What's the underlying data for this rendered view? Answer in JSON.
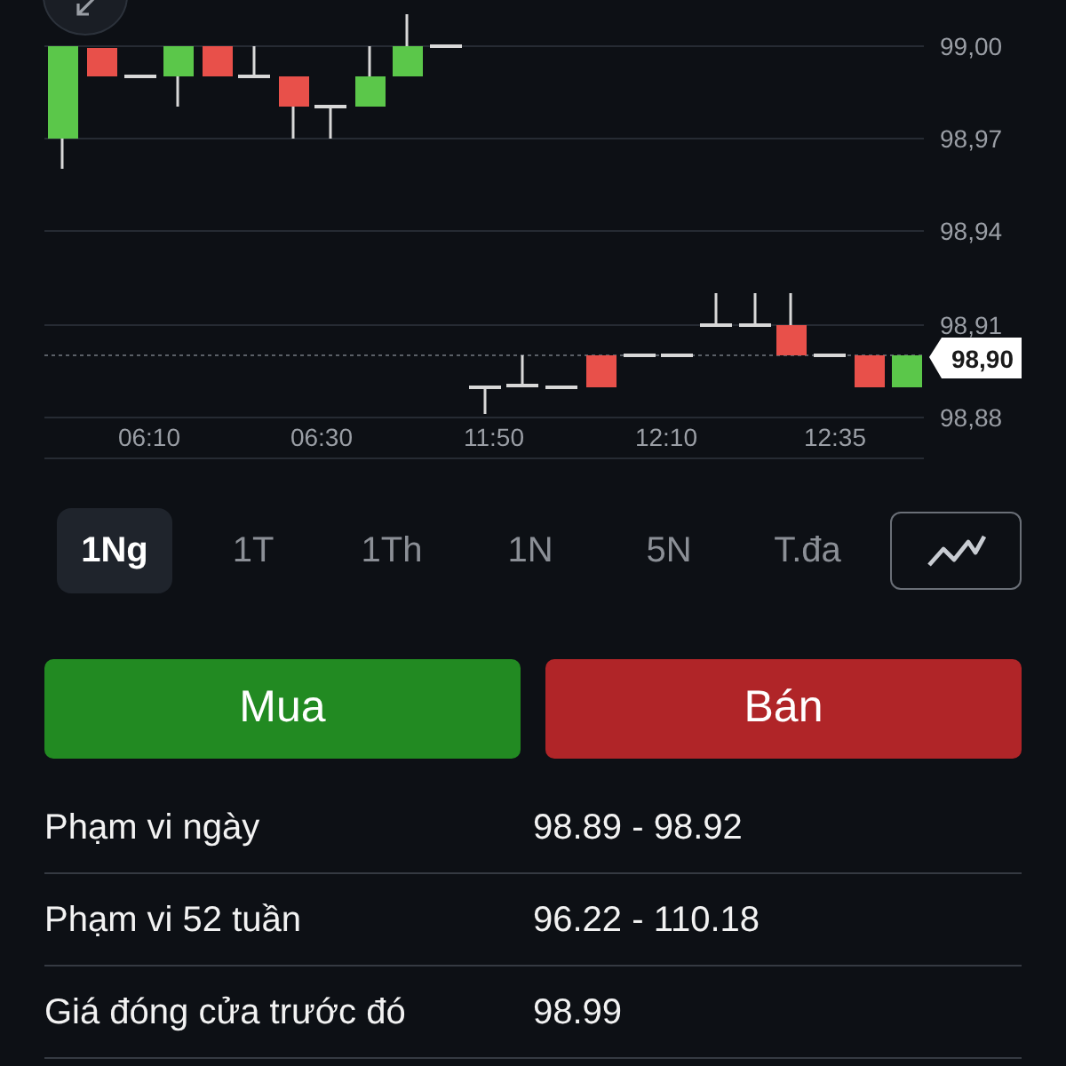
{
  "chart": {
    "y_axis_labels": [
      "99,00",
      "98,97",
      "98,94",
      "98,91",
      "98,88"
    ],
    "x_axis_labels": [
      "06:10",
      "06:30",
      "11:50",
      "12:10",
      "12:35"
    ],
    "current_price": "98,90"
  },
  "periods": [
    {
      "label": "1Ng",
      "selected": true
    },
    {
      "label": "1T",
      "selected": false
    },
    {
      "label": "1Th",
      "selected": false
    },
    {
      "label": "1N",
      "selected": false
    },
    {
      "label": "5N",
      "selected": false
    },
    {
      "label": "T.đa",
      "selected": false
    }
  ],
  "actions": [
    {
      "label": "Mua",
      "kind": "buy"
    },
    {
      "label": "Bán",
      "kind": "sell"
    }
  ],
  "stats": [
    {
      "label": "Phạm vi ngày",
      "value": "98.89 - 98.92"
    },
    {
      "label": "Phạm vi 52 tuần",
      "value": "96.22 - 110.18"
    },
    {
      "label": "Giá đóng cửa trước đó",
      "value": "98.99"
    }
  ]
}
